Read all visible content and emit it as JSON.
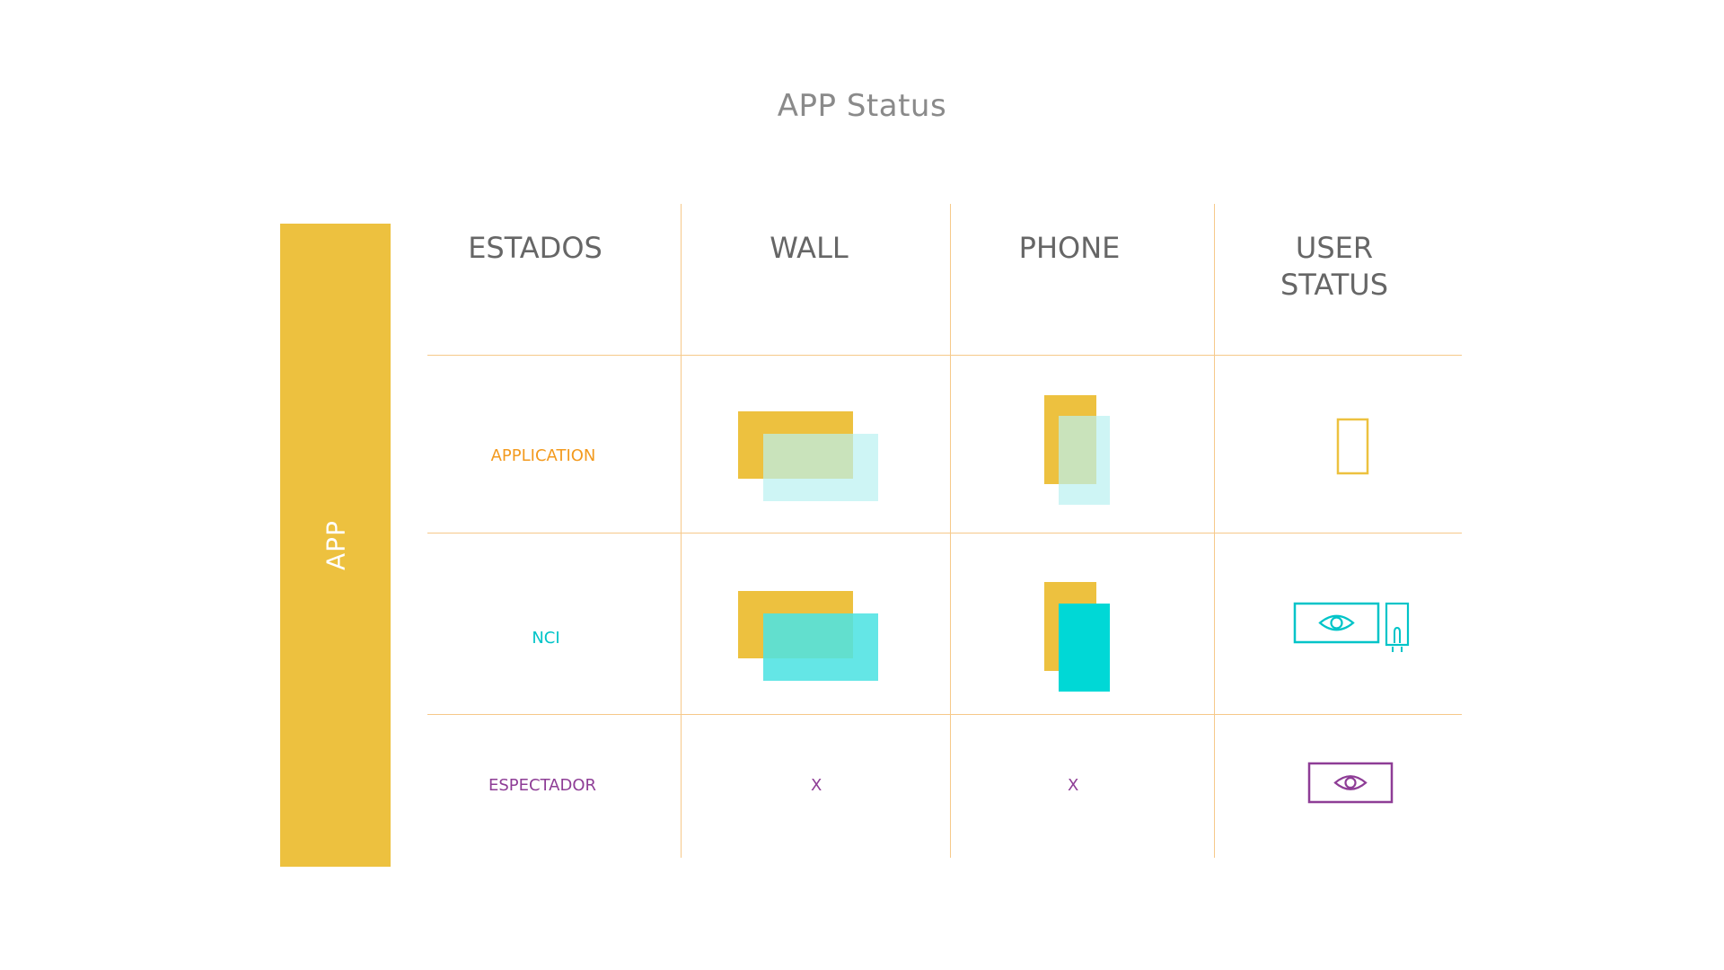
{
  "title": "APP Status",
  "side_label": "APP",
  "columns": [
    "ESTADOS",
    "WALL",
    "PHONE",
    "USER\nSTATUS"
  ],
  "rows": [
    {
      "label": "APPLICATION",
      "wall": "",
      "phone": "",
      "user_status_icon": "phone-outline-icon"
    },
    {
      "label": "NCI",
      "wall": "",
      "phone": "",
      "user_status_icon": "wall-eye-phone-touch-icon"
    },
    {
      "label": "ESPECTADOR",
      "wall": "X",
      "phone": "X",
      "user_status_icon": "eye-icon"
    }
  ],
  "colors": {
    "accent_yellow": "#edc13f",
    "grid_line": "#f6c98a",
    "application": "#f39a1e",
    "nci": "#00c4c8",
    "espectador": "#8e3d96",
    "title_text": "#8a8a8a",
    "header_text": "#666666",
    "light_cyan": "#b9f1f1",
    "mid_cyan": "#4fe3e3",
    "solid_cyan": "#00d8d6"
  }
}
